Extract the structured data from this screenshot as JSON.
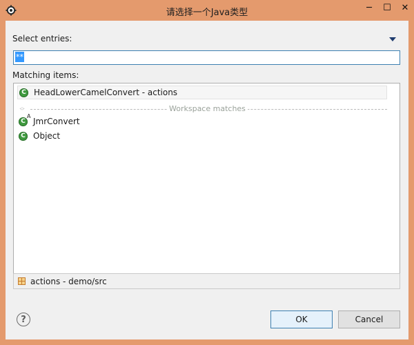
{
  "window": {
    "title": "请选择一个Java类型",
    "app_icon": "gear-icon",
    "controls": {
      "minimize": "─",
      "maximize": "☐",
      "close": "✕"
    }
  },
  "select_label": "Select entries:",
  "filter": {
    "value": "**"
  },
  "matching_label": "Matching items:",
  "items": [
    {
      "label": "HeadLowerCamelConvert - actions",
      "icon": "class-icon",
      "selected": true
    },
    {
      "label": "JmrConvert",
      "icon": "abstract-class-icon",
      "overlay": "A"
    },
    {
      "label": "Object",
      "icon": "class-icon"
    }
  ],
  "separator": {
    "label": "Workspace matches"
  },
  "status": {
    "text": "actions - demo/src",
    "icon": "package-icon"
  },
  "buttons": {
    "help": "?",
    "ok": "OK",
    "cancel": "Cancel"
  },
  "colors": {
    "frame": "#e49a6d",
    "selection": "#3399ff",
    "class_icon": "#3f9a3f"
  }
}
